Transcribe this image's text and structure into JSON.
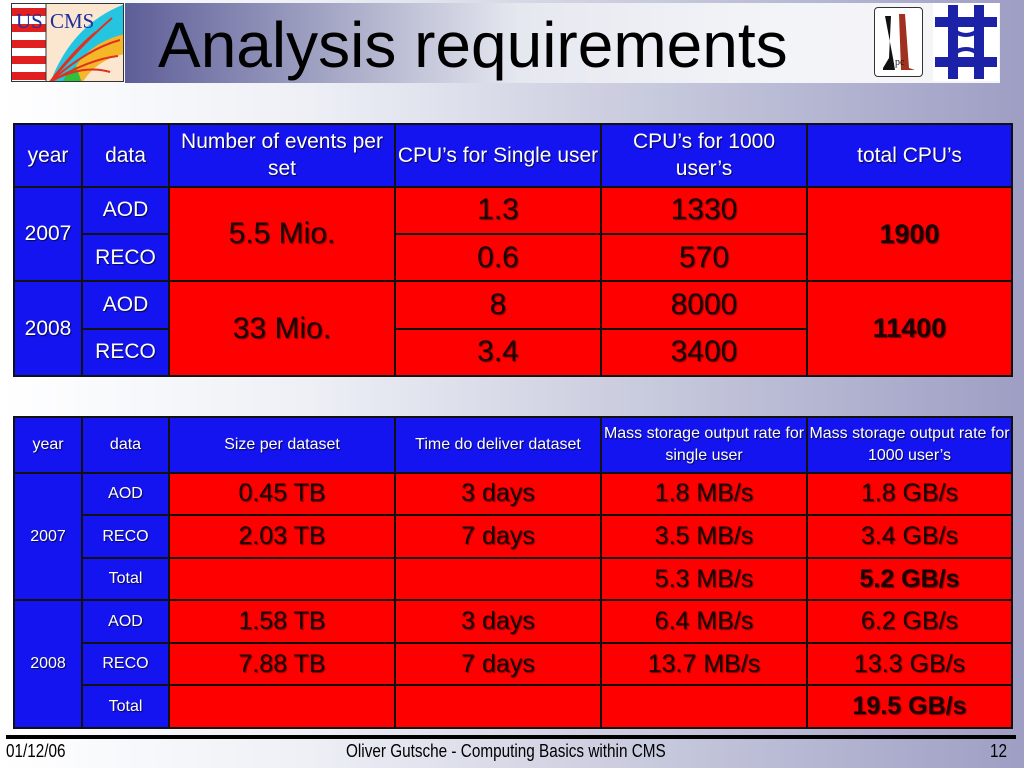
{
  "slide": {
    "title": "Analysis requirements",
    "logos": [
      "uscms-logo",
      "lpc-logo",
      "fermilab-logo"
    ],
    "colors": {
      "header_cell": "#1414f0",
      "data_cell": "#ff0000",
      "header_text": "#ffffff",
      "data_text": "#1a0000"
    }
  },
  "cpu_table": {
    "headers": [
      "year",
      "data",
      "Number of events per set",
      "CPU’s for Single user",
      "CPU’s for 1000 user’s",
      "total CPU’s"
    ],
    "years": [
      {
        "year": "2007",
        "events": "5.5 Mio.",
        "total_cpus": "1900",
        "rows": [
          {
            "data": "AOD",
            "cpu_single": "1.3",
            "cpu_1000": "1330"
          },
          {
            "data": "RECO",
            "cpu_single": "0.6",
            "cpu_1000": "570"
          }
        ]
      },
      {
        "year": "2008",
        "events": "33 Mio.",
        "total_cpus": "11400",
        "rows": [
          {
            "data": "AOD",
            "cpu_single": "8",
            "cpu_1000": "8000"
          },
          {
            "data": "RECO",
            "cpu_single": "3.4",
            "cpu_1000": "3400"
          }
        ]
      }
    ]
  },
  "storage_table": {
    "headers": [
      "year",
      "data",
      "Size per dataset",
      "Time do deliver dataset",
      "Mass storage output rate for single user",
      "Mass storage output rate for 1000 user’s"
    ],
    "years": [
      {
        "year": "2007",
        "rows": [
          {
            "data": "AOD",
            "size": "0.45 TB",
            "time": "3 days",
            "rate_single": "1.8 MB/s",
            "rate_1000": "1.8 GB/s"
          },
          {
            "data": "RECO",
            "size": "2.03 TB",
            "time": "7 days",
            "rate_single": "3.5 MB/s",
            "rate_1000": "3.4 GB/s"
          },
          {
            "data": "Total",
            "size": "",
            "time": "",
            "rate_single": "5.3 MB/s",
            "rate_1000": "5.2 GB/s"
          }
        ]
      },
      {
        "year": "2008",
        "rows": [
          {
            "data": "AOD",
            "size": "1.58 TB",
            "time": "3 days",
            "rate_single": "6.4 MB/s",
            "rate_1000": "6.2 GB/s"
          },
          {
            "data": "RECO",
            "size": "7.88 TB",
            "time": "7 days",
            "rate_single": "13.7 MB/s",
            "rate_1000": "13.3 GB/s"
          },
          {
            "data": "Total",
            "size": "",
            "time": "",
            "rate_single": "",
            "rate_1000": "19.5 GB/s"
          }
        ]
      }
    ]
  },
  "footer": {
    "date": "01/12/06",
    "center": "Oliver Gutsche - Computing Basics within CMS",
    "page": "12"
  }
}
